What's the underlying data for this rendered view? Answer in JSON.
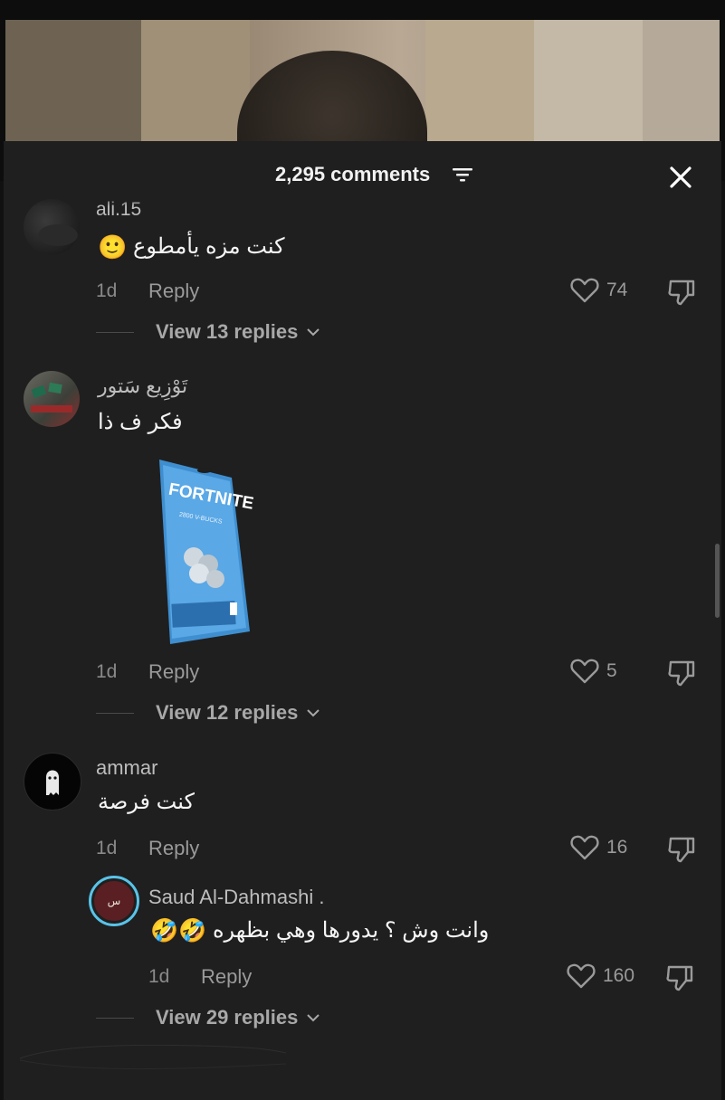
{
  "header": {
    "count_label": "2,295 comments",
    "close_icon": "close-icon",
    "filter_icon": "filter-icon"
  },
  "comments": [
    {
      "username": "ali.15",
      "text": "كنت مزه يأمطوع",
      "emoji": "🙂",
      "age": "1d",
      "reply_label": "Reply",
      "likes": "74",
      "view_replies": "View 13 replies"
    },
    {
      "username": "تَوْزِيع سَتور",
      "text": "فكر ف ذا",
      "image": "fortnite-vbucks-card",
      "card_title": "FORTNITE",
      "card_subtitle": "2800 V-BUCKS",
      "age": "1d",
      "reply_label": "Reply",
      "likes": "5",
      "view_replies": "View 12 replies"
    },
    {
      "username": "ammar",
      "text": "كنت فرصة",
      "age": "1d",
      "reply_label": "Reply",
      "likes": "16"
    }
  ],
  "reply": {
    "username": "Saud Al-Dahmashi .",
    "avatar_text": "س",
    "text": "وانت وش ؟ يدورها وهي بظهره",
    "emoji": "🤣🤣",
    "age": "1d",
    "reply_label": "Reply",
    "likes": "160",
    "view_replies": "View 29 replies"
  },
  "colors": {
    "sheet_bg": "#1f1f1f",
    "text_primary": "#f5f5f5",
    "text_secondary": "#8a8a8a",
    "avatar_ring": "#59c3e8"
  }
}
